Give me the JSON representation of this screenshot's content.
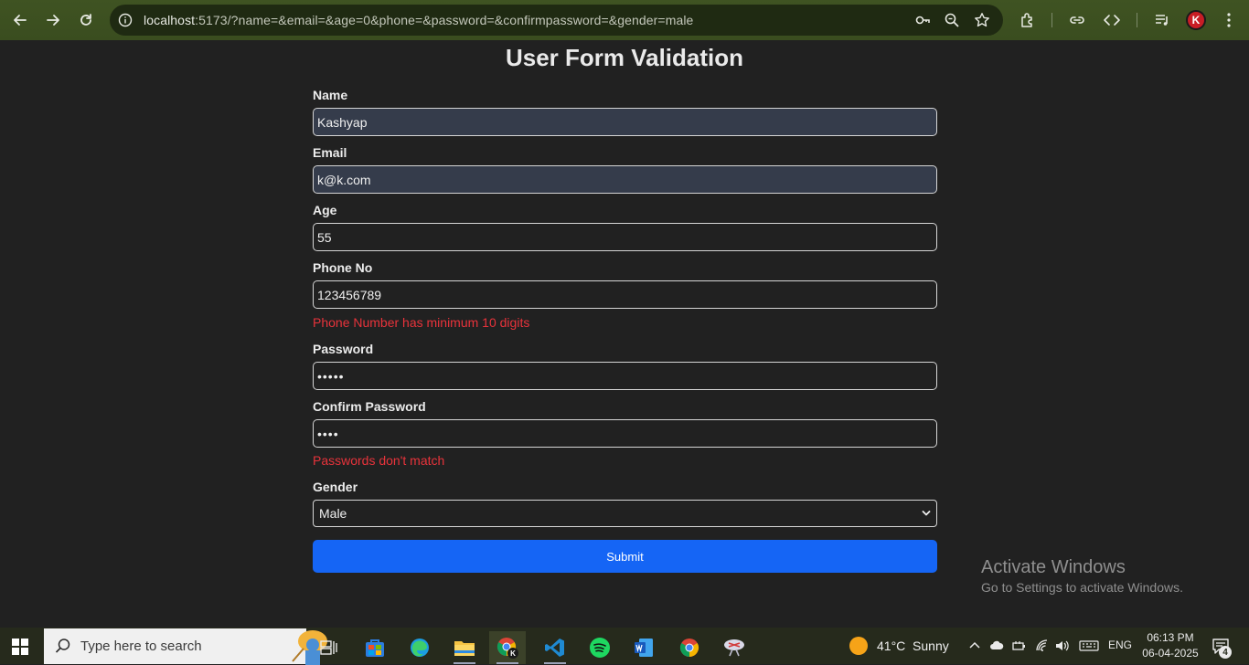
{
  "browser": {
    "url_host": "localhost",
    "url_rest": ":5173/?name=&email=&age=0&phone=&password=&confirmpassword=&gender=male",
    "profile_letter": "K"
  },
  "form": {
    "title": "User Form Validation",
    "name_label": "Name",
    "name_value": "Kashyap",
    "email_label": "Email",
    "email_value": "k@k.com",
    "age_label": "Age",
    "age_value": "55",
    "phone_label": "Phone No",
    "phone_value": "123456789",
    "phone_error": "Phone Number has minimum 10 digits",
    "password_label": "Password",
    "password_value": "•••••",
    "confirm_label": "Confirm Password",
    "confirm_value": "••••",
    "confirm_error": "Passwords don't match",
    "gender_label": "Gender",
    "gender_value": "Male",
    "submit_label": "Submit"
  },
  "watermark": {
    "title": "Activate Windows",
    "subtitle": "Go to Settings to activate Windows."
  },
  "taskbar": {
    "search_placeholder": "Type here to search",
    "weather": "41°C  Sunny",
    "language": "ENG",
    "time": "06:13 PM",
    "date": "06-04-2025",
    "notification_count": "4"
  },
  "colors": {
    "accent_button": "#1565f5",
    "error_text": "#e8333b",
    "autofill_bg": "#353c4b"
  }
}
